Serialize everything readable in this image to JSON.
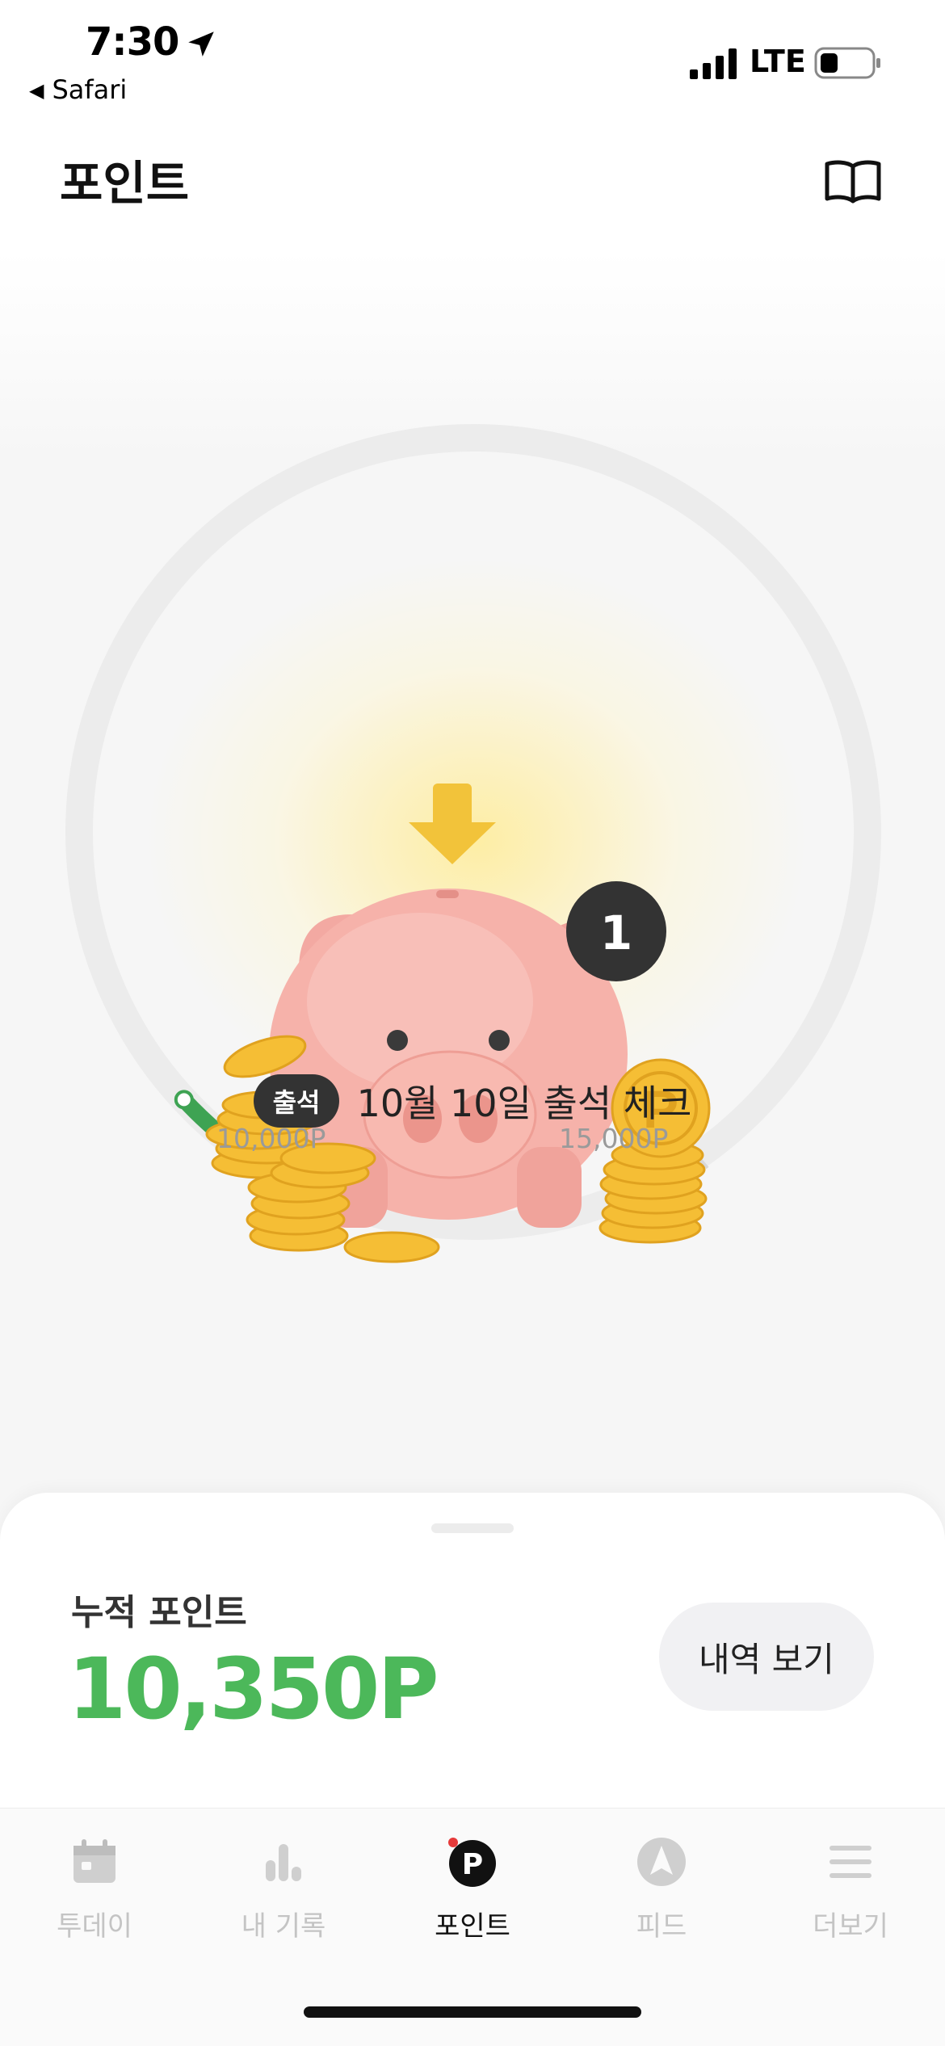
{
  "status_bar": {
    "time": "7:30",
    "back_app": "Safari",
    "network": "LTE",
    "battery_level": 0.35
  },
  "header": {
    "title": "포인트",
    "guide_icon": "book-icon"
  },
  "progress": {
    "min_label": "10,000P",
    "max_label": "15,000P",
    "min_value": 10000,
    "max_value": 15000,
    "current_value": 10350,
    "accent_color": "#3ea353",
    "badge_count": "1"
  },
  "attendance": {
    "badge": "출석",
    "text": "10월 10일 출석 체크"
  },
  "summary": {
    "label": "누적 포인트",
    "value": "10,350P",
    "value_color": "#4cb85a",
    "history_button": "내역 보기"
  },
  "tabs": [
    {
      "label": "투데이",
      "icon": "calendar-icon",
      "active": false
    },
    {
      "label": "내 기록",
      "icon": "bar-chart-icon",
      "active": false
    },
    {
      "label": "포인트",
      "icon": "point-icon",
      "active": true
    },
    {
      "label": "피드",
      "icon": "compass-icon",
      "active": false
    },
    {
      "label": "더보기",
      "icon": "menu-icon",
      "active": false
    }
  ]
}
